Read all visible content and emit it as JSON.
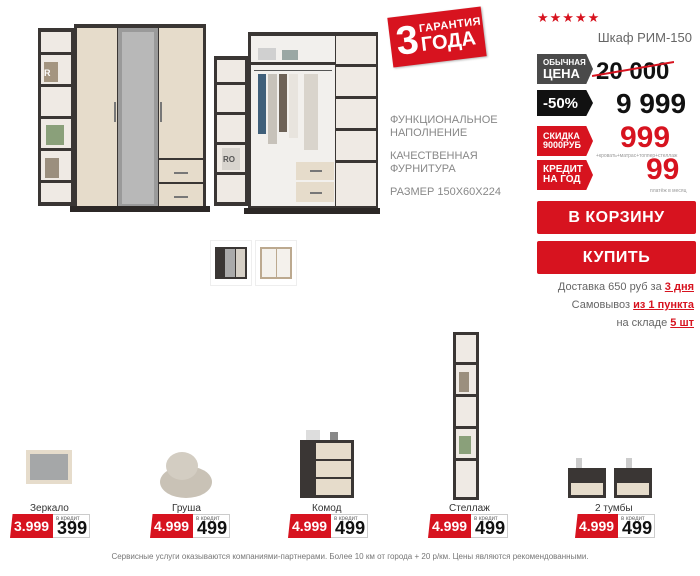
{
  "guarantee": {
    "number": "3",
    "line1": "ГАРАНТИЯ",
    "line2": "ГОДА"
  },
  "features": [
    "ФУНКЦИОНАЛЬНОЕ НАПОЛНЕНИЕ",
    "КАЧЕСТВЕННАЯ ФУРНИТУРА",
    "РАЗМЕР 150х60х224"
  ],
  "product": {
    "rating_stars": "★★★★★",
    "title": "Шкаф РИМ-150",
    "regular_label_1": "ОБЫЧНАЯ",
    "regular_label_2": "ЦЕНА",
    "old_price": "20 000",
    "discount_label": "-50%",
    "sale_price": "9 999",
    "bonus_label_1": "СКИДКА",
    "bonus_label_2": "9000РУБ",
    "bonus_price": "999",
    "bonus_note": "+кровать+матрас+топпер+стеллаж",
    "credit_label_1": "КРЕДИТ",
    "credit_label_2": "НА ГОД",
    "credit_price": "99",
    "credit_note": "платёж в месяц"
  },
  "buttons": {
    "cart": "В КОРЗИНУ",
    "buy": "КУПИТЬ"
  },
  "delivery": {
    "line1_prefix": "Доставка 650 руб за ",
    "line1_value": "3 дня",
    "line2_prefix": "Самовывоз ",
    "line2_value": "из 1 пункта",
    "line3_prefix": "на складе ",
    "line3_value": "5 шт"
  },
  "related": [
    {
      "name": "Зеркало",
      "price": "3.999",
      "credit_label": "в кредит",
      "credit": "399"
    },
    {
      "name": "Груша",
      "price": "4.999",
      "credit_label": "в кредит",
      "credit": "499"
    },
    {
      "name": "Комод",
      "price": "4.999",
      "credit_label": "в кредит",
      "credit": "499"
    },
    {
      "name": "Стеллаж",
      "price": "4.999",
      "credit_label": "в кредит",
      "credit": "499"
    },
    {
      "name": "2 тумбы",
      "price": "4.999",
      "credit_label": "в кредит",
      "credit": "499"
    }
  ],
  "footer_note": "Сервисные услуги оказываются компаниями-партнерами. Более 10 км от города + 20 р/км. Цены являются рекомендованными.",
  "colors": {
    "accent": "#d7131f",
    "dark_wood": "#3a3634",
    "light_wood": "#e6dccb"
  }
}
